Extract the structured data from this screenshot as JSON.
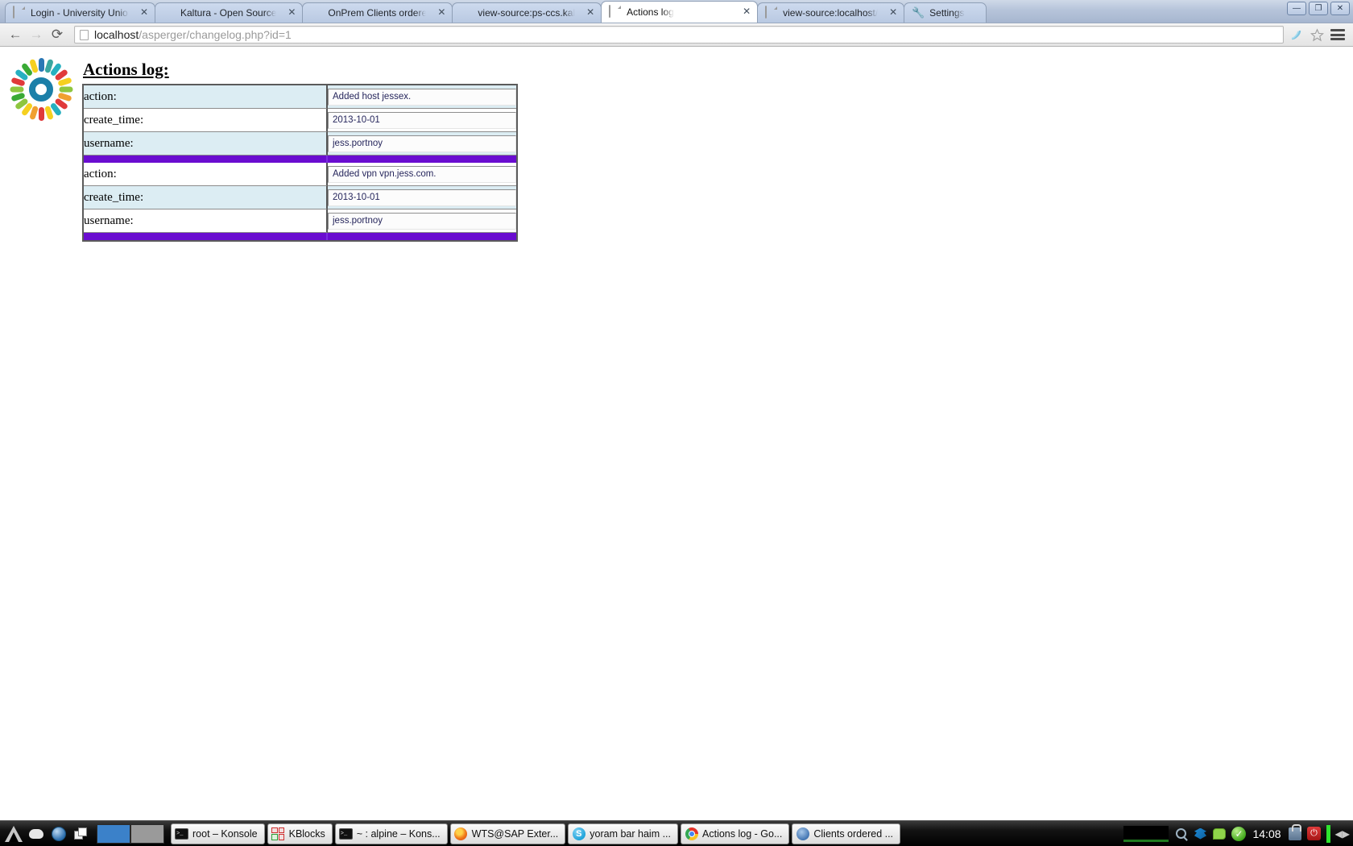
{
  "browser": {
    "tabs": [
      {
        "title": "Login - University Union",
        "icon": "page-icon",
        "active": false
      },
      {
        "title": "Kaltura - Open Source",
        "icon": "kaltura-icon",
        "active": false
      },
      {
        "title": "OnPrem Clients ordered",
        "icon": "kaltura-icon",
        "active": false
      },
      {
        "title": "view-source:ps-ccs.kal",
        "icon": "kaltura-icon",
        "active": false
      },
      {
        "title": "Actions log",
        "icon": "page-icon",
        "active": true
      },
      {
        "title": "view-source:localhost/",
        "icon": "page-icon",
        "active": false
      },
      {
        "title": "Settings",
        "icon": "wrench-icon",
        "active": false
      }
    ],
    "window_controls": {
      "minimize": "—",
      "maximize": "❐",
      "close": "✕"
    },
    "nav": {
      "back": "←",
      "forward": "→",
      "reload": "⟳"
    },
    "url": {
      "domain": "localhost",
      "path": "/asperger/changelog.php?id=1"
    },
    "toolbar_icons": [
      "extension-icon",
      "bookmark-star-icon",
      "chrome-menu-icon"
    ]
  },
  "page": {
    "logo_name": "asperger-sunburst-logo",
    "title": "Actions log:",
    "logo_colors": [
      "#e03a3a",
      "#f0a030",
      "#f5d020",
      "#8ec63f",
      "#3aaa35",
      "#27b0c0",
      "#2a77b5"
    ],
    "hub_color": "#1b7fa8",
    "separator_color": "#6a0dd0",
    "row_alt_color": "#dcedf3",
    "entries": [
      {
        "rows": [
          {
            "label": "action:",
            "value": "Added host jessex."
          },
          {
            "label": "create_time:",
            "value": "2013-10-01"
          },
          {
            "label": "username:",
            "value": "jess.portnoy"
          }
        ]
      },
      {
        "rows": [
          {
            "label": "action:",
            "value": "Added vpn vpn.jess.com."
          },
          {
            "label": "create_time:",
            "value": "2013-10-01"
          },
          {
            "label": "username:",
            "value": "jess.portnoy"
          }
        ]
      }
    ]
  },
  "taskbar": {
    "launchers": [
      "kmenu-icon",
      "mouse-icon",
      "globe-icon",
      "windows-icon"
    ],
    "pager": [
      "desktop-1",
      "desktop-2"
    ],
    "tasks": [
      {
        "label": "root – Konsole",
        "icon": "konsole-icon"
      },
      {
        "label": "KBlocks",
        "icon": "kblocks-icon"
      },
      {
        "label": "~ : alpine – Kons...",
        "icon": "konsole-icon"
      },
      {
        "label": "WTS@SAP Exter...",
        "icon": "firefox-icon"
      },
      {
        "label": "yoram bar haim ...",
        "icon": "skype-icon"
      },
      {
        "label": "Actions log - Go...",
        "icon": "chrome-icon"
      },
      {
        "label": "Clients ordered ...",
        "icon": "firefox-icon"
      }
    ],
    "tray_icons": [
      "search-icon",
      "dropbox-icon",
      "chat-icon",
      "check-icon",
      "lock-icon",
      "power-icon"
    ],
    "clock": "14:08"
  }
}
